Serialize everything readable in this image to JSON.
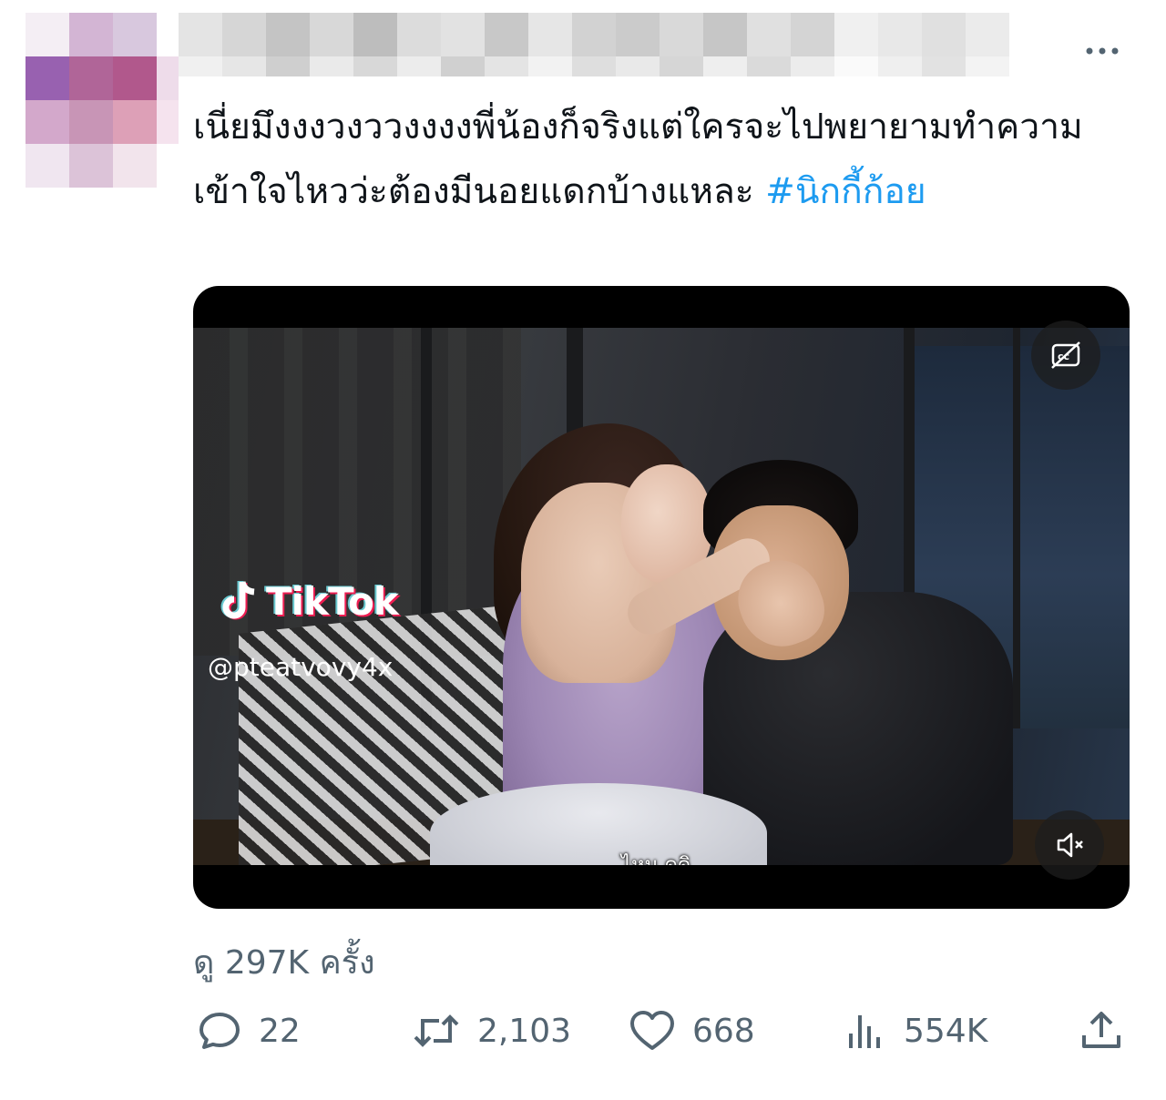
{
  "tweet": {
    "text": "เนี่ยมึงงงวงววงงงงพี่น้องก็จริงแต่ใครจะไปพยายามทำความเข้าใจไหวว่ะต้องมีนอยแดกบ้างแหละ ",
    "hashtag": "#นิกกี้ก้อย"
  },
  "video": {
    "watermark_brand": "TikTok",
    "watermark_handle": "@pteatvovy4x",
    "subtitle": "ไหน ดูดิ",
    "cc_icon": "captions-off-icon",
    "mute_icon": "volume-muted-icon"
  },
  "stats": {
    "views_label": "ดู 297K ครั้ง",
    "replies": "22",
    "retweets": "2,103",
    "likes": "668",
    "impressions": "554K"
  },
  "colors": {
    "accent": "#1d9bf0",
    "muted_text": "#536471",
    "text": "#0f1419"
  }
}
